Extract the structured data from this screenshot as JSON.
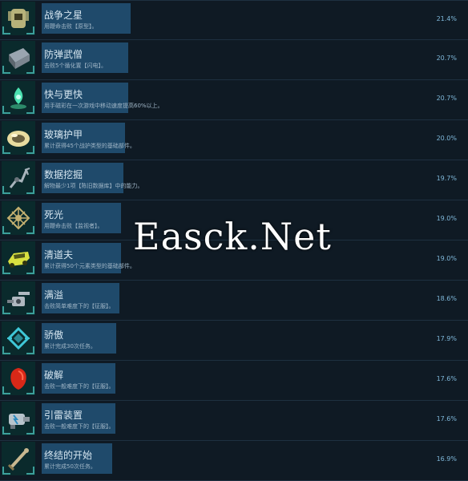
{
  "achievements": [
    {
      "title": "战争之星",
      "desc": "用鞭命击败【原型】。",
      "pct": "21.4%",
      "icon": "armor-torso-icon",
      "fill": 0.214,
      "color": "#b7b27a"
    },
    {
      "title": "防弹武僧",
      "desc": "击败5个循化置【闪电】。",
      "pct": "20.7%",
      "icon": "ammo-box-icon",
      "fill": 0.207,
      "color": "#9aa5b0"
    },
    {
      "title": "快与更快",
      "desc": "用手磁彩在一次游戏中移动速度提高60%以上。",
      "pct": "20.7%",
      "icon": "green-flame-icon",
      "fill": 0.207,
      "color": "#4be0b0"
    },
    {
      "title": "玻璃护甲",
      "desc": "累计获得45个战护类型的基础部件。",
      "pct": "20.0%",
      "icon": "glass-orb-icon",
      "fill": 0.2,
      "color": "#e8dca0"
    },
    {
      "title": "数据挖掘",
      "desc": "解物最少1项【陈旧数据库】中的能力。",
      "pct": "19.7%",
      "icon": "claw-arm-icon",
      "fill": 0.197,
      "color": "#a8b4bc"
    },
    {
      "title": "死光",
      "desc": "用鞭命击败【监视者】。",
      "pct": "19.0%",
      "icon": "lattice-core-icon",
      "fill": 0.19,
      "color": "#c4b070"
    },
    {
      "title": "清道夫",
      "desc": "累计获得50个元素类型的基础部件。",
      "pct": "19.0%",
      "icon": "yellow-vehicle-icon",
      "fill": 0.19,
      "color": "#d8e040"
    },
    {
      "title": "满溢",
      "desc": "击败简单难度下的【征服】。",
      "pct": "18.6%",
      "icon": "turret-gun-icon",
      "fill": 0.186,
      "color": "#b0b8c0"
    },
    {
      "title": "骄傲",
      "desc": "累计完成30次任务。",
      "pct": "17.9%",
      "icon": "cyan-drone-icon",
      "fill": 0.179,
      "color": "#3fc8d8"
    },
    {
      "title": "破解",
      "desc": "击败一般难度下的【征服】。",
      "pct": "17.6%",
      "icon": "red-shield-icon",
      "fill": 0.176,
      "color": "#d82818"
    },
    {
      "title": "引雷装置",
      "desc": "击败一般难度下的【征服】。",
      "pct": "17.6%",
      "icon": "lightning-device-icon",
      "fill": 0.176,
      "color": "#b8c4cc"
    },
    {
      "title": "终结的开始",
      "desc": "累计完成50次任务。",
      "pct": "16.9%",
      "icon": "sword-blade-icon",
      "fill": 0.169,
      "color": "#c8b890"
    }
  ],
  "watermark": "Easck.Net",
  "colors": {
    "bar": "#1f4a6b",
    "row_bg": "#0f1a24",
    "page_bg": "#1b2838",
    "pct": "#7fb8da"
  }
}
